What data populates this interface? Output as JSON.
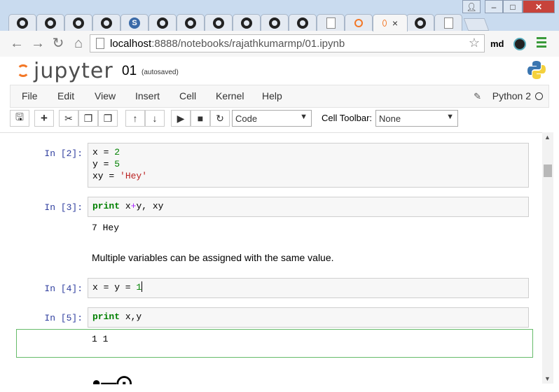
{
  "browser": {
    "tabs": [
      {
        "icon": "github-icon"
      },
      {
        "icon": "github-icon"
      },
      {
        "icon": "github-icon"
      },
      {
        "icon": "github-icon"
      },
      {
        "icon": "sourcegraph-icon"
      },
      {
        "icon": "github-icon"
      },
      {
        "icon": "github-icon"
      },
      {
        "icon": "github-icon"
      },
      {
        "icon": "github-icon"
      },
      {
        "icon": "github-icon"
      },
      {
        "icon": "document-icon"
      },
      {
        "icon": "jupyter-icon"
      },
      {
        "icon": "jupyter-icon",
        "active": true
      },
      {
        "icon": "github-icon"
      },
      {
        "icon": "document-icon"
      }
    ],
    "active_tab_close": "×",
    "url_host": "localhost",
    "url_path": ":8888/notebooks/rajathkumarmp/01.ipynb",
    "profile": "md"
  },
  "jupyter": {
    "logo_text": "jupyter",
    "notebook_name": "01",
    "save_status": "(autosaved)",
    "menu": [
      "File",
      "Edit",
      "View",
      "Insert",
      "Cell",
      "Kernel",
      "Help"
    ],
    "kernel_name": "Python 2",
    "cell_type": "Code",
    "cell_toolbar_label": "Cell Toolbar:",
    "cell_toolbar_value": "None"
  },
  "cells": [
    {
      "prompt": "In [2]:"
    },
    {
      "prompt": "In [3]:",
      "output": "7 Hey"
    },
    {
      "markdown": "Multiple variables can be assigned with the same value."
    },
    {
      "prompt": "In [4]:"
    },
    {
      "prompt": "In [5]:",
      "output": "1 1"
    }
  ],
  "colors": {
    "accent": "#f37726",
    "prompt": "#303f9f",
    "selected_border": "#66bb6a"
  }
}
